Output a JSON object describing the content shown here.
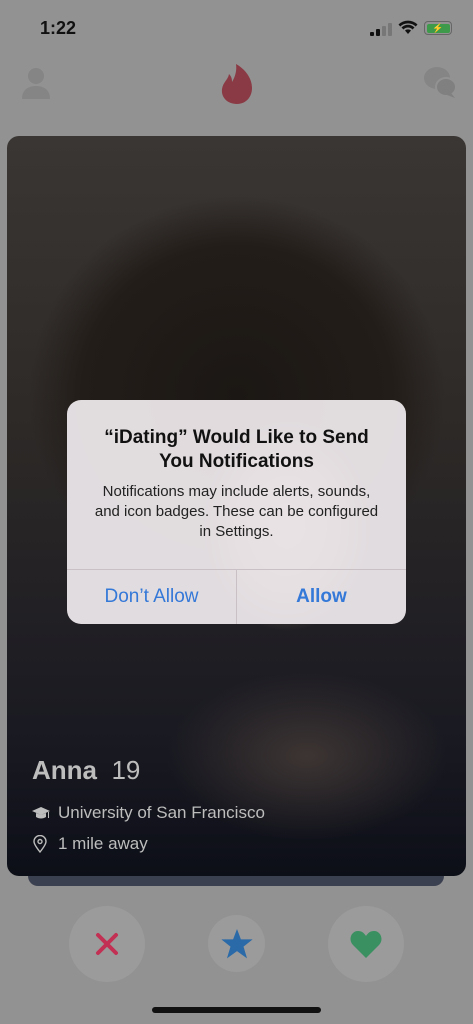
{
  "status_bar": {
    "time": "1:22"
  },
  "colors": {
    "flame": "#8a3a44",
    "nope": "#c23054",
    "superlike": "#2a6aa8",
    "like": "#3a9060",
    "link": "#3478d8"
  },
  "profile": {
    "name": "Anna",
    "age": "19",
    "school": "University of San Francisco",
    "distance": "1 mile away"
  },
  "alert": {
    "title": "“iDating” Would Like to Send You Notifications",
    "message": "Notifications may include alerts, sounds, and icon badges. These can be configured in Settings.",
    "deny_label": "Don’t Allow",
    "allow_label": "Allow"
  }
}
